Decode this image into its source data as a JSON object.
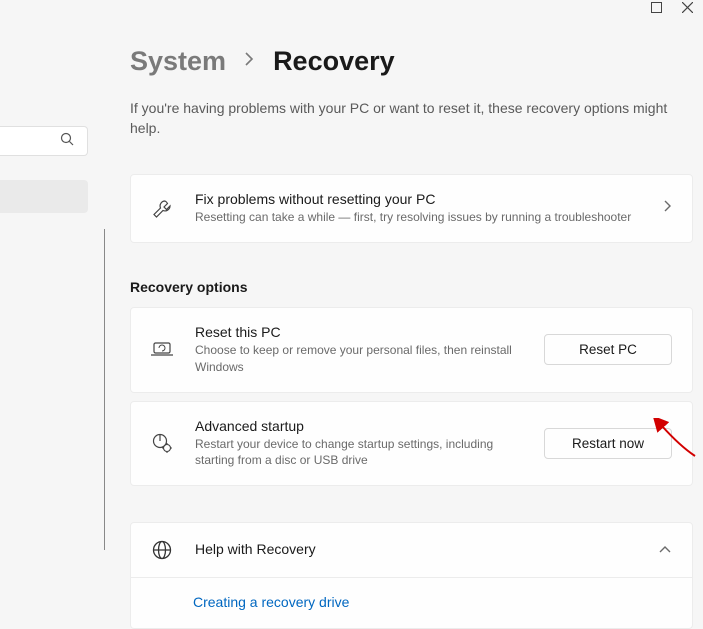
{
  "breadcrumb": {
    "parent": "System",
    "current": "Recovery"
  },
  "subtitle": "If you're having problems with your PC or want to reset it, these recovery options might help.",
  "troubleshoot": {
    "title": "Fix problems without resetting your PC",
    "desc": "Resetting can take a while — first, try resolving issues by running a troubleshooter"
  },
  "section_heading": "Recovery options",
  "reset": {
    "title": "Reset this PC",
    "desc": "Choose to keep or remove your personal files, then reinstall Windows",
    "button": "Reset PC"
  },
  "advanced": {
    "title": "Advanced startup",
    "desc": "Restart your device to change startup settings, including starting from a disc or USB drive",
    "button": "Restart now"
  },
  "help": {
    "title": "Help with Recovery",
    "link1": "Creating a recovery drive"
  }
}
